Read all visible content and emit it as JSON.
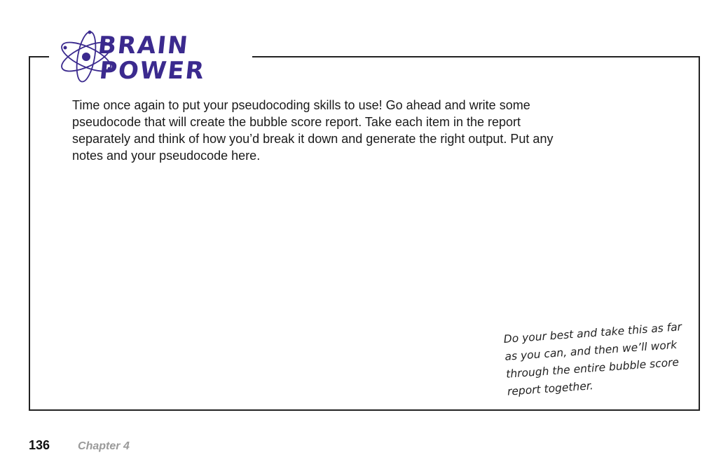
{
  "logo": {
    "line1": "BRAIN",
    "line2": "POWER",
    "colors": {
      "logo_text": "#3b2a8e",
      "atom": "#3b2a8e"
    },
    "icon": "atom-icon"
  },
  "content": {
    "lines": [
      "Time once again to put your pseudocoding skills to use! Go ahead and write some",
      "pseudocode that will create the bubble score report. Take each item in the report",
      "separately and think of how you’d break it down and generate the right output. Put any",
      "notes and your pseudocode here."
    ]
  },
  "note": {
    "lines": [
      "Do your best and take this as far",
      "as you can, and then we’ll work",
      "through the entire bubble score",
      "report together."
    ]
  },
  "footer": {
    "page_number": "136",
    "chapter": "Chapter 4"
  }
}
